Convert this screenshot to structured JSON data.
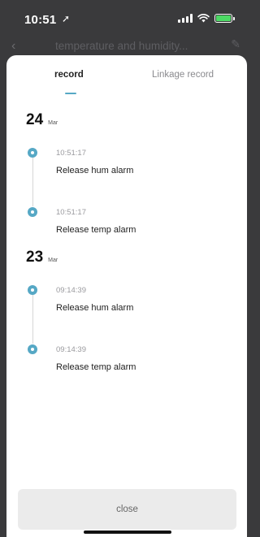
{
  "status_bar": {
    "time": "10:51"
  },
  "background": {
    "title": "temperature and humidity..."
  },
  "tabs": [
    {
      "label": "record",
      "active": true
    },
    {
      "label": "Linkage record",
      "active": false
    }
  ],
  "groups": [
    {
      "day": "24",
      "month": "Mar",
      "events": [
        {
          "time": "10:51:17",
          "text": "Release hum alarm"
        },
        {
          "time": "10:51:17",
          "text": "Release temp alarm"
        }
      ]
    },
    {
      "day": "23",
      "month": "Mar",
      "events": [
        {
          "time": "09:14:39",
          "text": "Release hum alarm"
        },
        {
          "time": "09:14:39",
          "text": "Release temp alarm"
        }
      ]
    }
  ],
  "close_label": "close",
  "colors": {
    "accent": "#56a8c5",
    "battery": "#4cd964"
  }
}
